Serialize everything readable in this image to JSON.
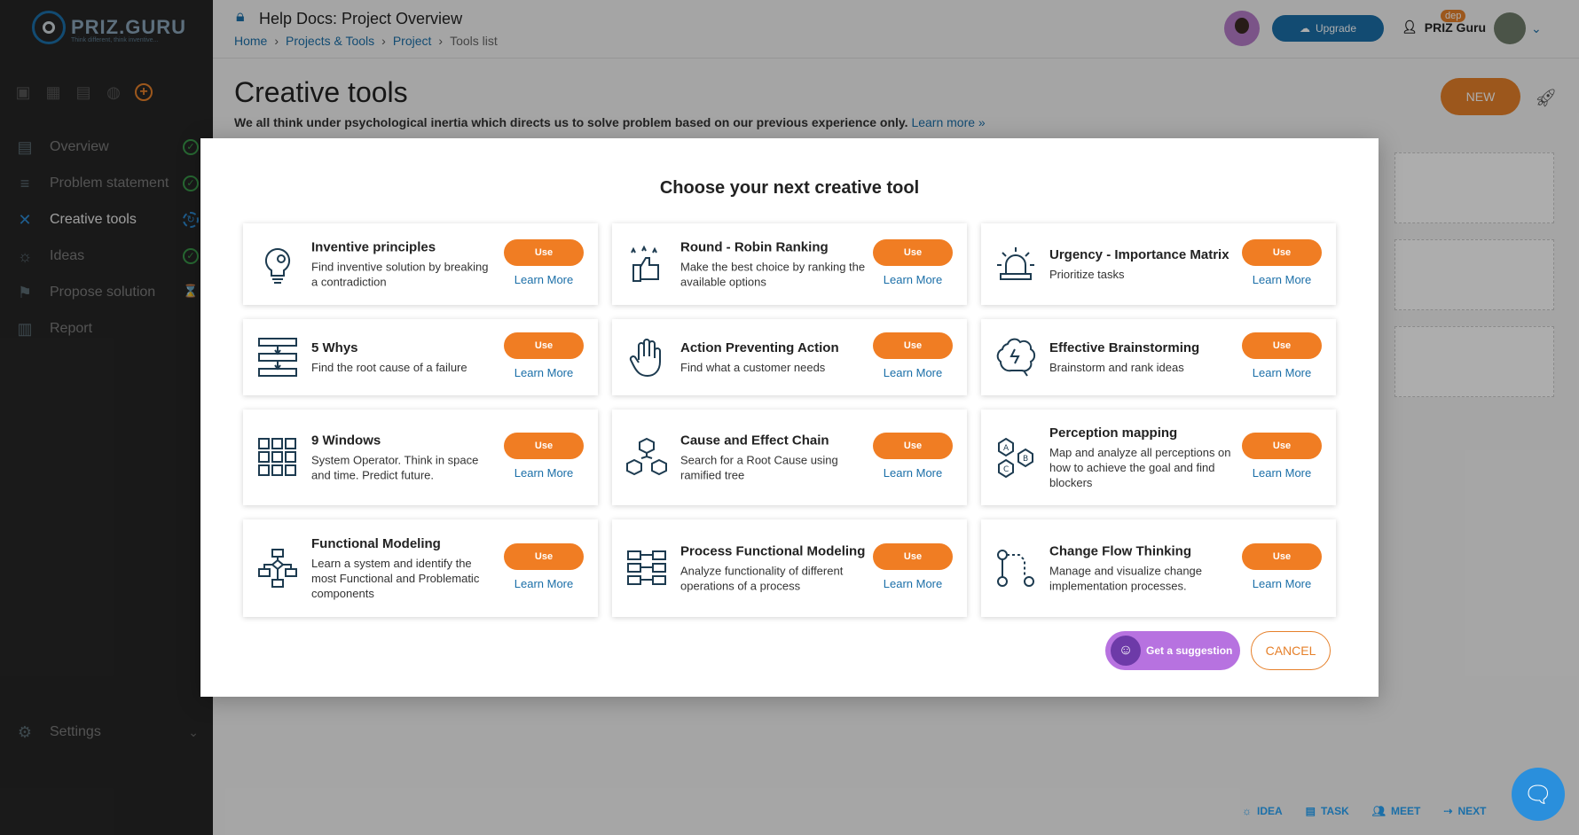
{
  "app": {
    "logo_text": "PRIZ.GURU",
    "tagline": "Think different, think inventive..."
  },
  "sidebar": {
    "items": [
      {
        "label": "Overview",
        "status": "✓"
      },
      {
        "label": "Problem statement",
        "status": "✓"
      },
      {
        "label": "Creative tools",
        "status": "↻"
      },
      {
        "label": "Ideas",
        "status": "✓"
      },
      {
        "label": "Propose solution",
        "status": "⌛"
      },
      {
        "label": "Report",
        "status": ""
      }
    ],
    "settings": "Settings"
  },
  "header": {
    "title": "Help Docs: Project Overview",
    "breadcrumb": [
      "Home",
      "Projects & Tools",
      "Project",
      "Tools list"
    ],
    "upgrade": "Upgrade",
    "user": "PRIZ Guru",
    "badge": "dep"
  },
  "main": {
    "title": "Creative tools",
    "subtitle": "We all think under psychological inertia which directs us to solve problem based on our previous experience only.",
    "learn_more": "Learn more »",
    "new_button": "NEW"
  },
  "modal": {
    "title": "Choose your next creative tool",
    "use_label": "Use",
    "learn_label": "Learn More",
    "tools": [
      {
        "title": "Inventive principles",
        "desc": "Find inventive solution by breaking a contradiction",
        "icon": "lightbulb-gear-icon"
      },
      {
        "title": "Round - Robin Ranking",
        "desc": "Make the best choice by ranking the available options",
        "icon": "thumbs-up-stars-icon"
      },
      {
        "title": "Urgency - Importance Matrix",
        "desc": "Prioritize tasks",
        "icon": "alarm-siren-icon"
      },
      {
        "title": "5 Whys",
        "desc": "Find the root cause of a failure",
        "icon": "stacked-arrows-icon"
      },
      {
        "title": "Action Preventing Action",
        "desc": "Find what a customer needs",
        "icon": "hand-stop-icon"
      },
      {
        "title": "Effective Brainstorming",
        "desc": "Brainstorm and rank ideas",
        "icon": "brain-icon"
      },
      {
        "title": "9 Windows",
        "desc": "System Operator. Think in space and time. Predict future.",
        "icon": "nine-grid-icon"
      },
      {
        "title": "Cause and Effect Chain",
        "desc": "Search for a Root Cause using ramified tree",
        "icon": "cubes-tree-icon"
      },
      {
        "title": "Perception mapping",
        "desc": "Map and analyze all perceptions on how to achieve the goal and find blockers",
        "icon": "abc-hexagons-icon"
      },
      {
        "title": "Functional Modeling",
        "desc": "Learn a system and identify the most Functional and Problematic components",
        "icon": "flowchart-icon"
      },
      {
        "title": "Process Functional Modeling",
        "desc": "Analyze functionality of different operations of a process",
        "icon": "process-blocks-icon"
      },
      {
        "title": "Change Flow Thinking",
        "desc": "Manage and visualize change implementation processes.",
        "icon": "flow-nodes-icon"
      }
    ],
    "suggestion": "Get a suggestion",
    "cancel": "CANCEL"
  },
  "bottom_bar": [
    "IDEA",
    "TASK",
    "MEET",
    "NEXT"
  ],
  "colors": {
    "accent": "#f07d23",
    "brand": "#1b6fa8",
    "sidebar_bg": "#262626"
  }
}
